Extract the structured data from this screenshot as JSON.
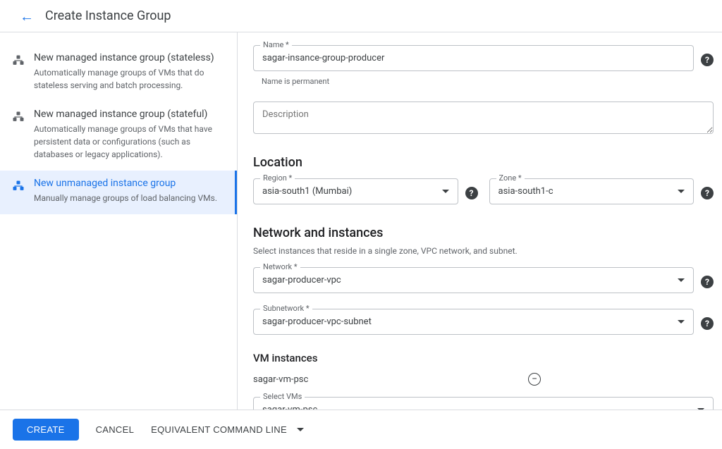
{
  "header": {
    "title": "Create Instance Group"
  },
  "sidebar": {
    "items": [
      {
        "title": "New managed instance group (stateless)",
        "desc": "Automatically manage groups of VMs that do stateless serving and batch processing."
      },
      {
        "title": "New managed instance group (stateful)",
        "desc": "Automatically manage groups of VMs that have persistent data or configurations (such as databases or legacy applications)."
      },
      {
        "title": "New unmanaged instance group",
        "desc": "Manually manage groups of load balancing VMs."
      }
    ]
  },
  "form": {
    "name_label": "Name *",
    "name_value": "sagar-insance-group-producer",
    "name_hint": "Name is permanent",
    "description_placeholder": "Description",
    "location_title": "Location",
    "region_label": "Region *",
    "region_value": "asia-south1 (Mumbai)",
    "zone_label": "Zone *",
    "zone_value": "asia-south1-c",
    "net_title": "Network and instances",
    "net_desc": "Select instances that reside in a single zone, VPC network, and subnet.",
    "network_label": "Network *",
    "network_value": "sagar-producer-vpc",
    "subnet_label": "Subnetwork *",
    "subnet_value": "sagar-producer-vpc-subnet",
    "vm_instances_title": "VM instances",
    "vm_selected": "sagar-vm-psc",
    "select_vms_label": "Select VMs",
    "select_vms_value": "sagar-vm-psc"
  },
  "footer": {
    "create": "CREATE",
    "cancel": "CANCEL",
    "cmd": "EQUIVALENT COMMAND LINE"
  }
}
